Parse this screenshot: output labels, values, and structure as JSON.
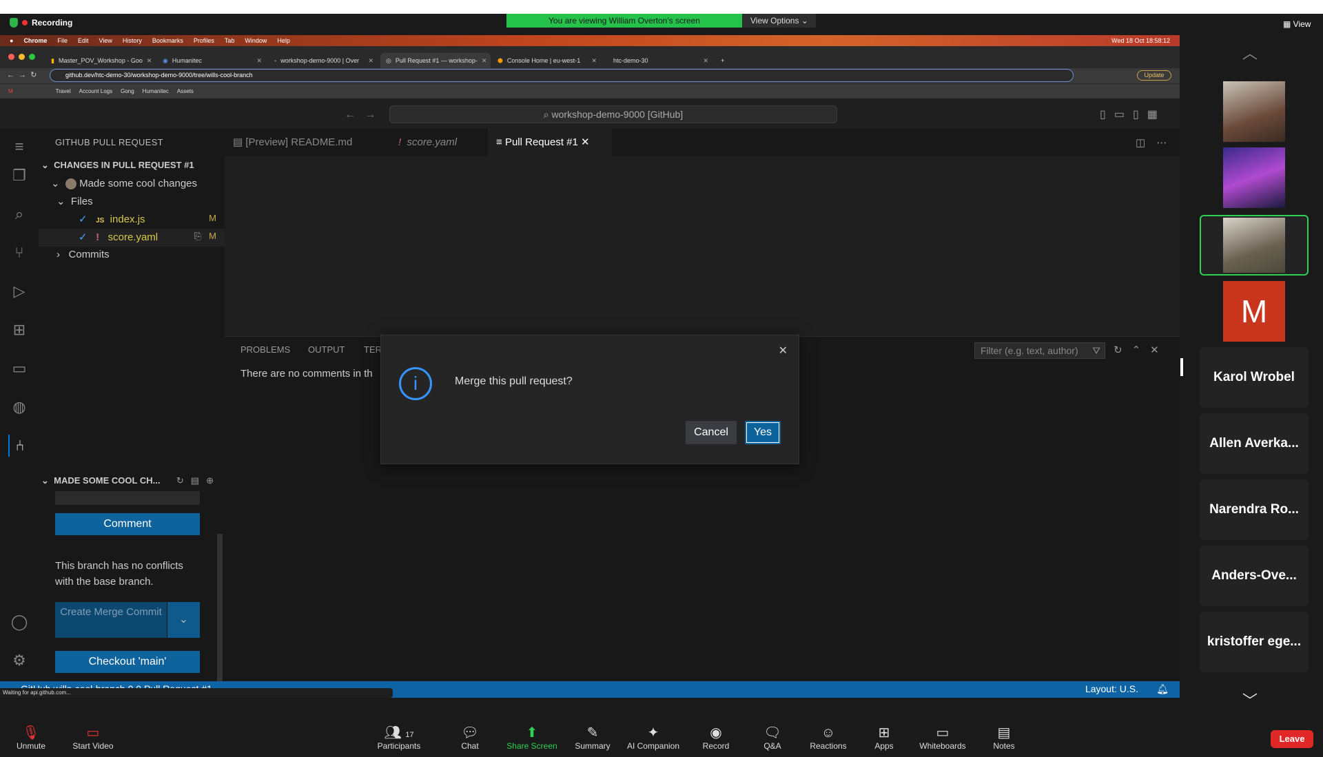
{
  "zoom": {
    "recording": "Recording",
    "viewing_banner": "You are viewing William Overton's screen",
    "view_options": "View Options",
    "view": "View",
    "participant_tiles": [
      "Karol Wrobel",
      "Allen Averka...",
      "Narendra Ro...",
      "Anders-Ove...",
      "kristoffer ege..."
    ],
    "avatar_letter": "M",
    "toolbar": [
      {
        "label": "Unmute",
        "icon": "mic-off-icon"
      },
      {
        "label": "Start Video",
        "icon": "video-off-icon"
      },
      {
        "label": "Participants",
        "icon": "participants-icon",
        "count": "17"
      },
      {
        "label": "Chat",
        "icon": "chat-icon"
      },
      {
        "label": "Share Screen",
        "icon": "share-screen-icon"
      },
      {
        "label": "Summary",
        "icon": "summary-icon"
      },
      {
        "label": "AI Companion",
        "icon": "ai-companion-icon"
      },
      {
        "label": "Record",
        "icon": "record-icon"
      },
      {
        "label": "Q&A",
        "icon": "qa-icon"
      },
      {
        "label": "Reactions",
        "icon": "reactions-icon"
      },
      {
        "label": "Apps",
        "icon": "apps-icon"
      },
      {
        "label": "Whiteboards",
        "icon": "whiteboards-icon"
      },
      {
        "label": "Notes",
        "icon": "notes-icon"
      }
    ],
    "leave": "Leave"
  },
  "mac_menu": {
    "app": "Chrome",
    "items": [
      "File",
      "Edit",
      "View",
      "History",
      "Bookmarks",
      "Profiles",
      "Tab",
      "Window",
      "Help"
    ],
    "clock": "Wed 18 Oct  18:58:12"
  },
  "chrome": {
    "tabs": [
      "Master_POV_Workshop - Goo",
      "Humanitec",
      "workshop-demo-9000 | Over",
      "Pull Request #1 — workshop-",
      "Console Home | eu-west-1",
      "htc-demo-30"
    ],
    "active_tab": 3,
    "url": "github.dev/htc-demo-30/workshop-demo-9000/tree/wills-cool-branch",
    "update": "Update",
    "bookmarks": [
      "Travel",
      "Account Logs",
      "Gong",
      "Humanitec",
      "Assets"
    ]
  },
  "vscode": {
    "command_center": "workshop-demo-9000 [GitHub]",
    "sidebar_title": "GITHUB PULL REQUEST",
    "section_changes": "CHANGES IN PULL REQUEST #1",
    "commit": "Made some cool changes",
    "files_label": "Files",
    "files": [
      {
        "name": "index.js",
        "badge": "M",
        "icon": "JS"
      },
      {
        "name": "score.yaml",
        "badge": "M",
        "icon": "!"
      }
    ],
    "commits_label": "Commits",
    "section2": "MADE SOME COOL CH...",
    "comment_btn": "Comment",
    "no_conflicts": "This branch has no conflicts with the base branch.",
    "merge_btn": "Create Merge Commit",
    "checkout_btn": "Checkout 'main'",
    "tabs": [
      "[Preview] README.md",
      "score.yaml",
      "Pull Request #1"
    ],
    "panel_tabs": [
      "PROBLEMS",
      "OUTPUT",
      "TER"
    ],
    "panel_text": "There are no comments in th",
    "filter_placeholder": "Filter (e.g. text, author)",
    "status_left": "GitHub   wills-cool-branch      0  0   Pull Request #1",
    "status_right": "Layout: U.S.",
    "waiting": "Waiting for api.github.com..."
  },
  "dialog": {
    "message": "Merge this pull request?",
    "cancel": "Cancel",
    "confirm": "Yes"
  }
}
